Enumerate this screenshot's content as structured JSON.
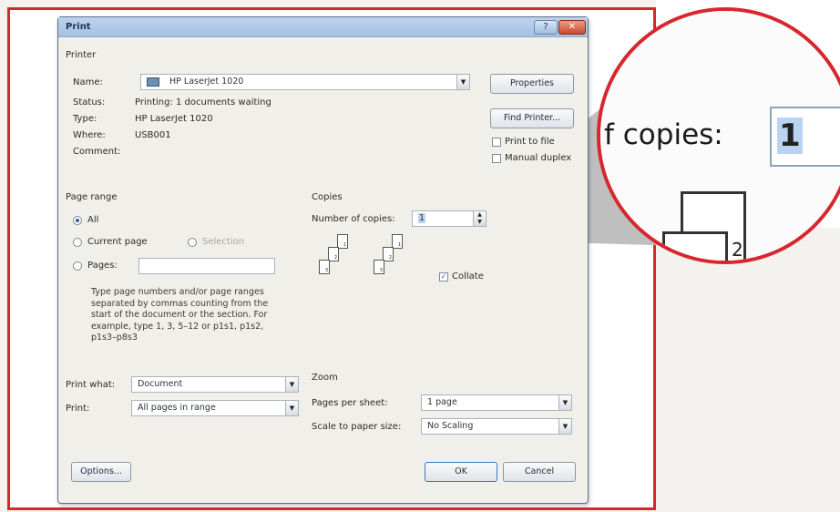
{
  "dialog": {
    "title": "Print",
    "title_buttons": {
      "help": "?",
      "close": "✕"
    }
  },
  "printer": {
    "group_label": "Printer",
    "name_label": "Name:",
    "name_value": "HP LaserJet 1020",
    "status_label": "Status:",
    "status_value": "Printing: 1 documents waiting",
    "type_label": "Type:",
    "type_value": "HP LaserJet 1020",
    "where_label": "Where:",
    "where_value": "USB001",
    "comment_label": "Comment:",
    "properties_button": "Properties",
    "find_printer_button": "Find Printer...",
    "print_to_file_label": "Print to file",
    "manual_duplex_label": "Manual duplex",
    "printer_icon": "printer-icon"
  },
  "page_range": {
    "group_label": "Page range",
    "all_label": "All",
    "current_page_label": "Current page",
    "selection_label": "Selection",
    "pages_label": "Pages:",
    "pages_value": "",
    "description": "Type page numbers and/or page ranges separated by commas counting from the start of the document or the section. For example, type 1, 3, 5–12 or p1s1, p1s2, p1s3–p8s3"
  },
  "copies": {
    "group_label": "Copies",
    "number_label": "Number of copies:",
    "number_value": "1",
    "collate_label": "Collate",
    "collate_checked": true,
    "page_numbers": [
      "1",
      "2",
      "3"
    ]
  },
  "print_options": {
    "print_what_label": "Print what:",
    "print_what_value": "Document",
    "print_label": "Print:",
    "print_value": "All pages in range"
  },
  "zoom": {
    "group_label": "Zoom",
    "pages_per_sheet_label": "Pages per sheet:",
    "pages_per_sheet_value": "1 page",
    "scale_label": "Scale to paper size:",
    "scale_value": "No Scaling"
  },
  "footer": {
    "options_button": "Options...",
    "ok_button": "OK",
    "cancel_button": "Cancel"
  },
  "magnifier": {
    "label_text": "f copies:",
    "value": "1",
    "page_digit": "2"
  },
  "colors": {
    "highlight_red": "#d8262e",
    "callout_gray": "#b8b8b8",
    "titlebar": "#a7c1e3"
  }
}
